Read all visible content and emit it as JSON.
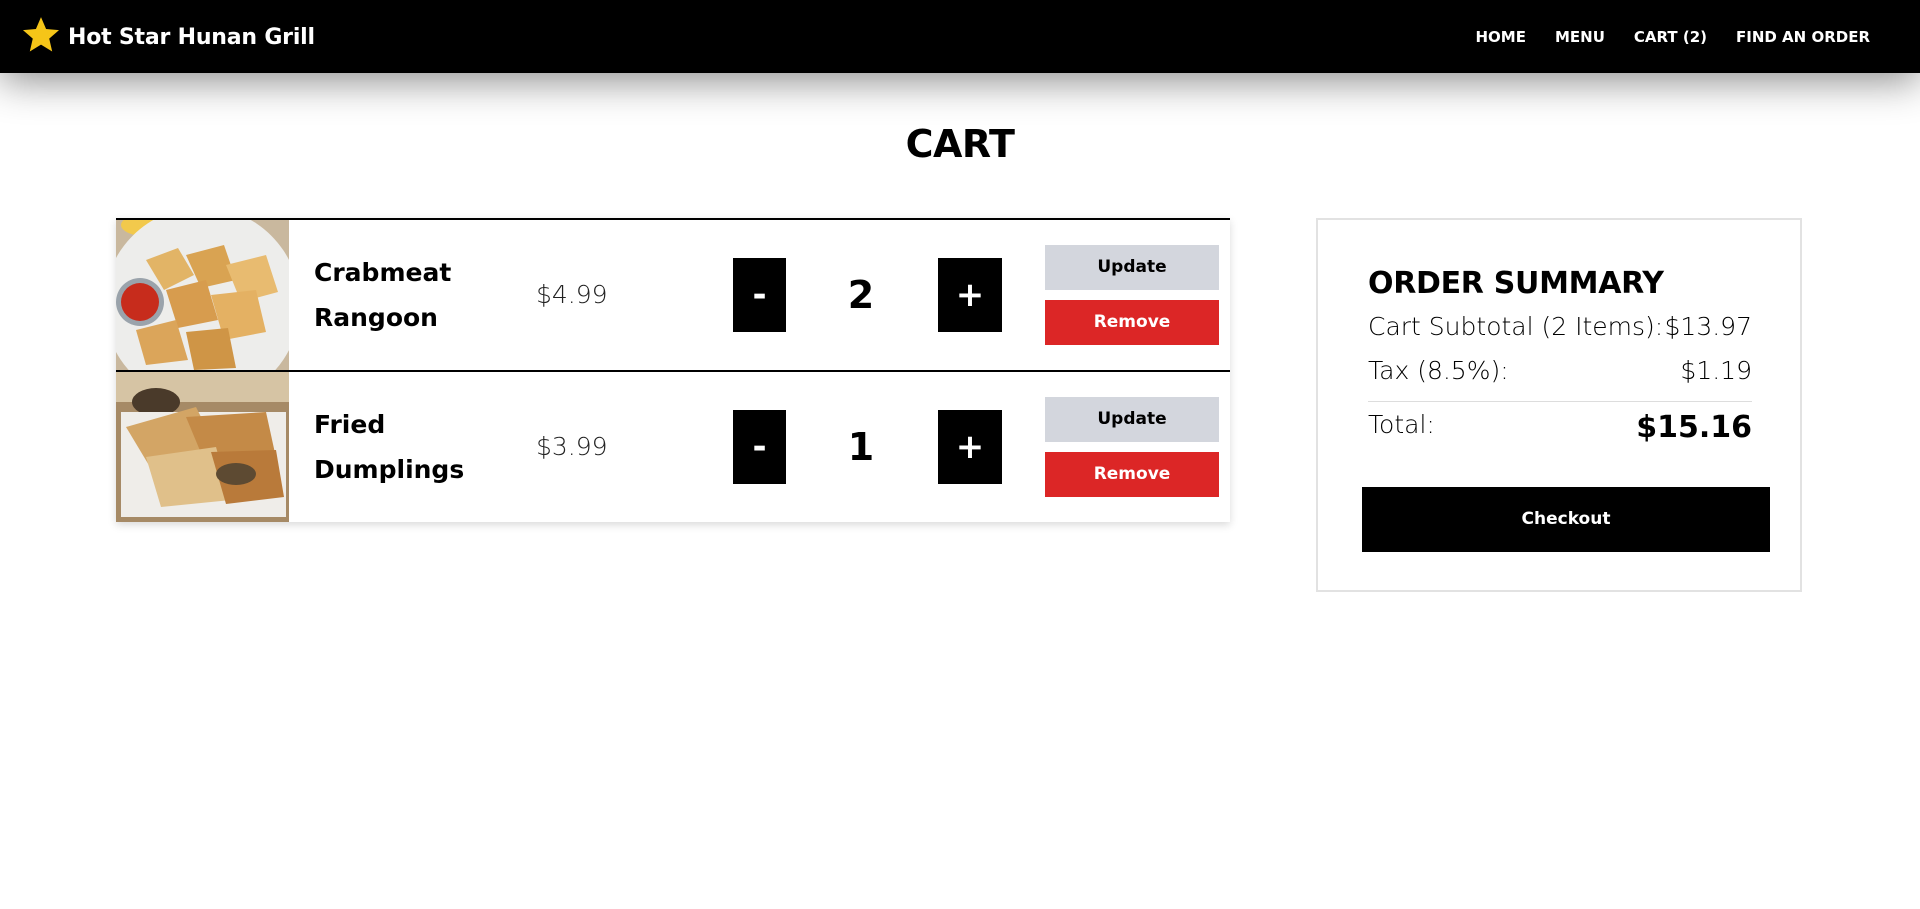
{
  "header": {
    "brand_name": "Hot Star Hunan Grill",
    "brand_icon": "star-icon",
    "brand_color": "#f5c518",
    "nav": [
      "HOME",
      "MENU",
      "CART (2)",
      "FIND AN ORDER"
    ]
  },
  "page": {
    "title": "CART"
  },
  "cart": {
    "items": [
      {
        "name": "Crabmeat Rangoon",
        "price": "$4.99",
        "quantity": "2",
        "minus": "-",
        "plus": "+",
        "update": "Update",
        "remove": "Remove"
      },
      {
        "name": "Fried Dumplings",
        "price": "$3.99",
        "quantity": "1",
        "minus": "-",
        "plus": "+",
        "update": "Update",
        "remove": "Remove"
      }
    ]
  },
  "summary": {
    "title": "ORDER SUMMARY",
    "subtotal_label": "Cart Subtotal (2 Items):",
    "subtotal_value": "$13.97",
    "tax_label": "Tax (8.5%):",
    "tax_value": "$1.19",
    "total_label": "Total:",
    "total_value": "$15.16",
    "checkout": "Checkout"
  },
  "colors": {
    "topbar": "#000000",
    "remove": "#dc2626",
    "update": "#d3d6dd"
  }
}
